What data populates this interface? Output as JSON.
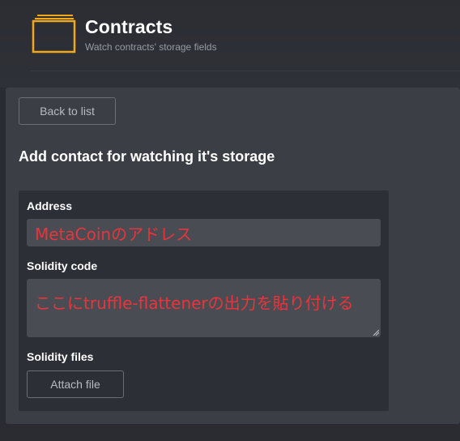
{
  "header": {
    "title": "Contracts",
    "subtitle": "Watch contracts' storage fields",
    "icon": "folder-stack-icon",
    "icon_color": "#f0a81c"
  },
  "toolbar": {
    "back_label": "Back to list"
  },
  "form": {
    "title": "Add contact for watching it's storage",
    "address": {
      "label": "Address",
      "value": "MetaCoinのアドレス"
    },
    "solidity_code": {
      "label": "Solidity code",
      "value": "ここにtruffle-flattenerの出力を貼り付ける"
    },
    "solidity_files": {
      "label": "Solidity files",
      "attach_label": "Attach file"
    }
  },
  "colors": {
    "background": "#2a2c32",
    "panel": "#3c3e45",
    "form_box": "#2d2f36",
    "input": "#4a4c53",
    "annotation_text": "#e8353b",
    "accent": "#f0a81c"
  }
}
